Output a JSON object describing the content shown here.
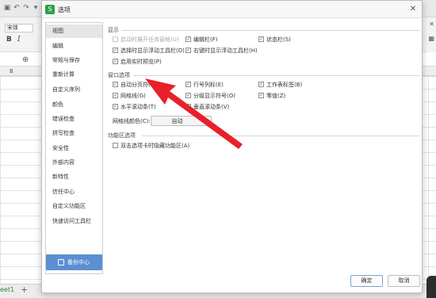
{
  "dialog": {
    "title": "选项",
    "title_icon": "S",
    "close_icon": "close-icon"
  },
  "background": {
    "font_name": "宋体",
    "bold": "B",
    "italic": "I",
    "column_b": "B",
    "sheet_tab": "eet1",
    "add_sheet": "+"
  },
  "sidebar": {
    "items": [
      {
        "label": "视图"
      },
      {
        "label": "编辑"
      },
      {
        "label": "常规与保存"
      },
      {
        "label": "重新计算"
      },
      {
        "label": "自定义序列"
      },
      {
        "label": "颜色"
      },
      {
        "label": "错误检查"
      },
      {
        "label": "拼写检查"
      },
      {
        "label": "安全性"
      },
      {
        "label": "外部内容"
      },
      {
        "label": "新特性"
      },
      {
        "label": "信任中心"
      },
      {
        "label": "自定义功能区"
      },
      {
        "label": "快速访问工具栏"
      }
    ],
    "backup_label": "备份中心"
  },
  "display": {
    "heading": "显示",
    "options": [
      {
        "label": "启动时展开任务窗格(U)",
        "checked": false,
        "disabled": true
      },
      {
        "label": "编辑栏(F)",
        "checked": true,
        "disabled": false
      },
      {
        "label": "状态栏(S)",
        "checked": true,
        "disabled": false
      },
      {
        "label": "选择时显示浮动工具栏(D)",
        "checked": true,
        "disabled": false
      },
      {
        "label": "右键时显示浮动工具栏(H)",
        "checked": true,
        "disabled": false
      },
      {
        "label": "启用实时预览(P)",
        "checked": true,
        "disabled": false
      }
    ]
  },
  "window_options": {
    "heading": "窗口选项",
    "options": [
      {
        "label": "自动分页符(K)",
        "checked": true
      },
      {
        "label": "行号列标(E)",
        "checked": true
      },
      {
        "label": "工作表标签(B)",
        "checked": true
      },
      {
        "label": "网格线(G)",
        "checked": true
      },
      {
        "label": "分级显示符号(O)",
        "checked": true
      },
      {
        "label": "零值(Z)",
        "checked": true
      },
      {
        "label": "水平滚动条(T)",
        "checked": true
      },
      {
        "label": "垂直滚动条(V)",
        "checked": true
      }
    ],
    "gridline_color_label": "网格线颜色(C):",
    "gridline_color_value": "自动"
  },
  "ribbon_options": {
    "heading": "功能区选项",
    "options": [
      {
        "label": "双击选项卡时隐藏功能区(A)",
        "checked": false
      }
    ]
  },
  "buttons": {
    "ok": "确定",
    "cancel": "取消"
  },
  "annotation": {
    "arrow_color": "#e8202a"
  }
}
